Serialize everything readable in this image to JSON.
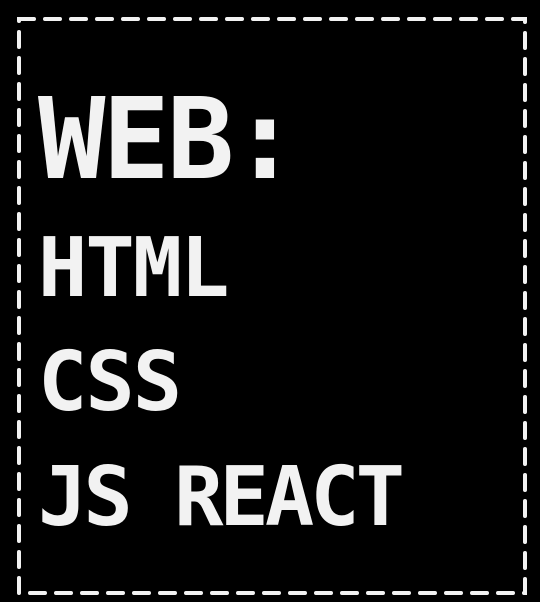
{
  "heading": "WEB:",
  "items": [
    "HTML",
    "CSS",
    "JS REACT"
  ],
  "colors": {
    "background": "#000000",
    "text": "#f2f2f2",
    "border": "#f2f2f2"
  }
}
